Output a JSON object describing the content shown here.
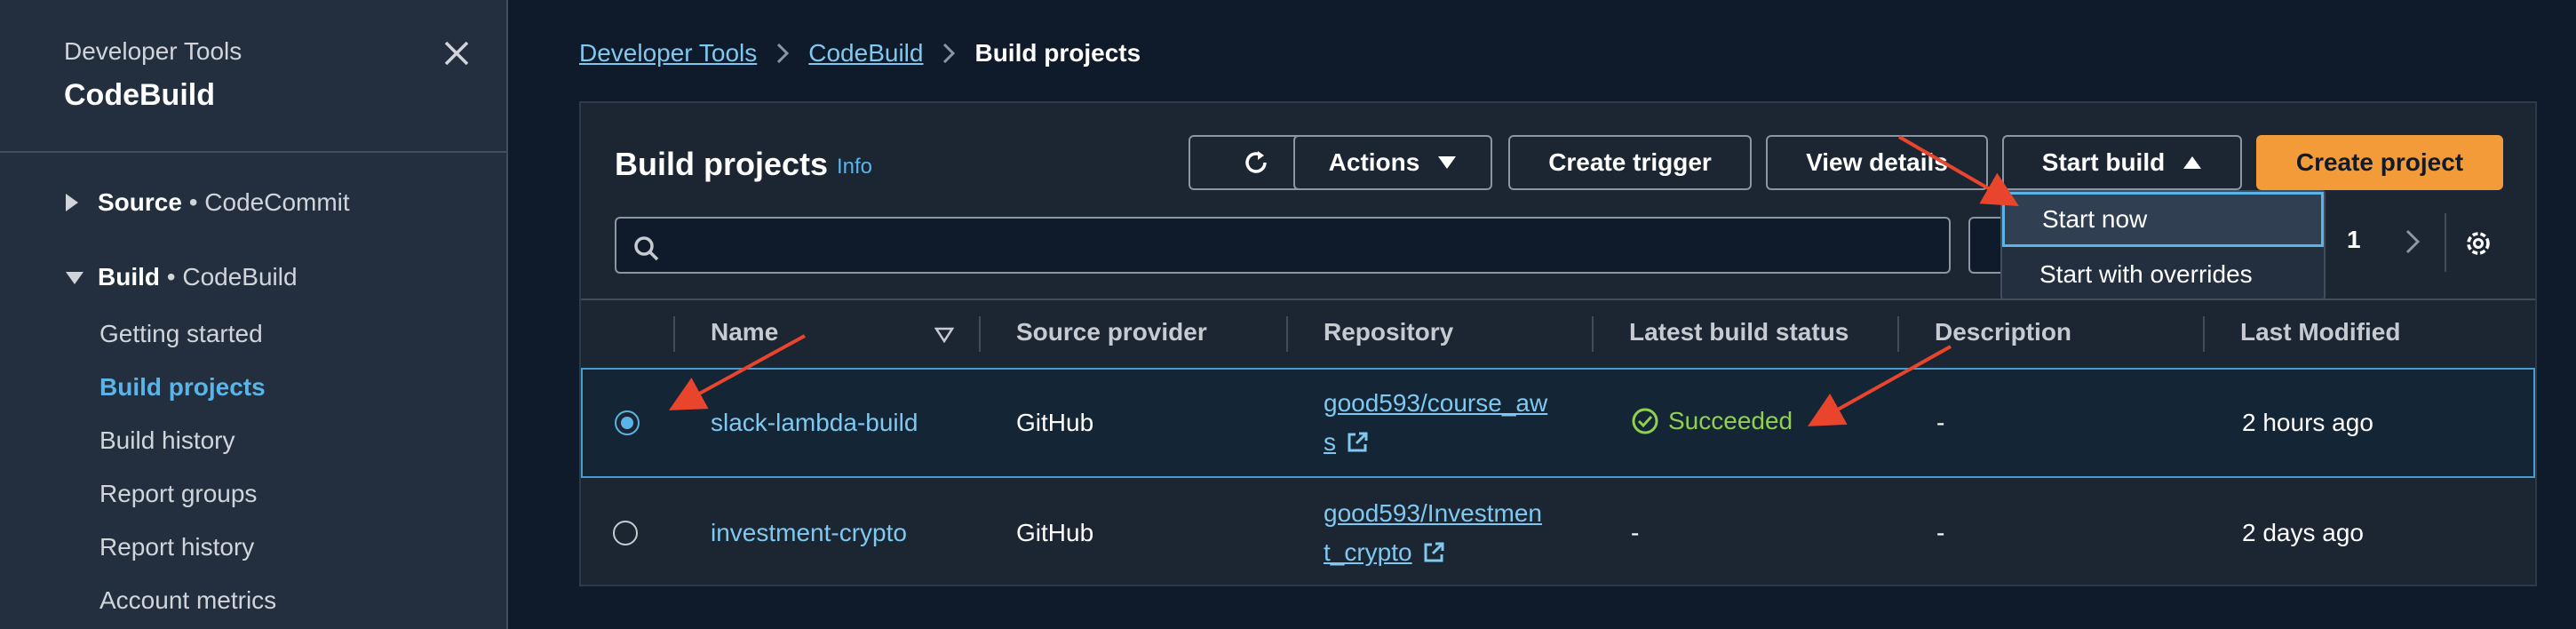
{
  "sidebar": {
    "service": "Developer Tools",
    "title": "CodeBuild",
    "sections": [
      {
        "bold": "Source",
        "rest": " • CodeCommit"
      },
      {
        "bold": "Build",
        "rest": " • CodeBuild"
      }
    ],
    "items": [
      {
        "label": "Getting started"
      },
      {
        "label": "Build projects"
      },
      {
        "label": "Build history"
      },
      {
        "label": "Report groups"
      },
      {
        "label": "Report history"
      },
      {
        "label": "Account metrics"
      }
    ]
  },
  "breadcrumb": {
    "items": [
      "Developer Tools",
      "CodeBuild"
    ],
    "current": "Build projects"
  },
  "panel": {
    "title": "Build projects",
    "info": "Info"
  },
  "toolbar": {
    "actions": "Actions",
    "create_trigger": "Create trigger",
    "view_details": "View details",
    "start_build": "Start build",
    "create_project": "Create project"
  },
  "search": {
    "placeholder": ""
  },
  "pager": {
    "page": "1"
  },
  "dropdown": {
    "items": [
      "Start now",
      "Start with overrides"
    ]
  },
  "table": {
    "headers": [
      "Name",
      "Source provider",
      "Repository",
      "Latest build status",
      "Description",
      "Last Modified"
    ],
    "rows": [
      {
        "name": "slack-lambda-build",
        "provider": "GitHub",
        "repo_line1": "good593/course_aw",
        "repo_line2": "s",
        "status": "Succeeded",
        "description": "-",
        "modified": "2 hours ago"
      },
      {
        "name": "investment-crypto",
        "provider": "GitHub",
        "repo_line1": "good593/Investmen",
        "repo_line2": "t_crypto",
        "status": "-",
        "description": "-",
        "modified": "2 days ago"
      }
    ]
  },
  "colors": {
    "accent": "#f29b38",
    "link": "#7fc8f0",
    "success": "#8fd14f",
    "annotation_arrow": "#e8452c"
  }
}
